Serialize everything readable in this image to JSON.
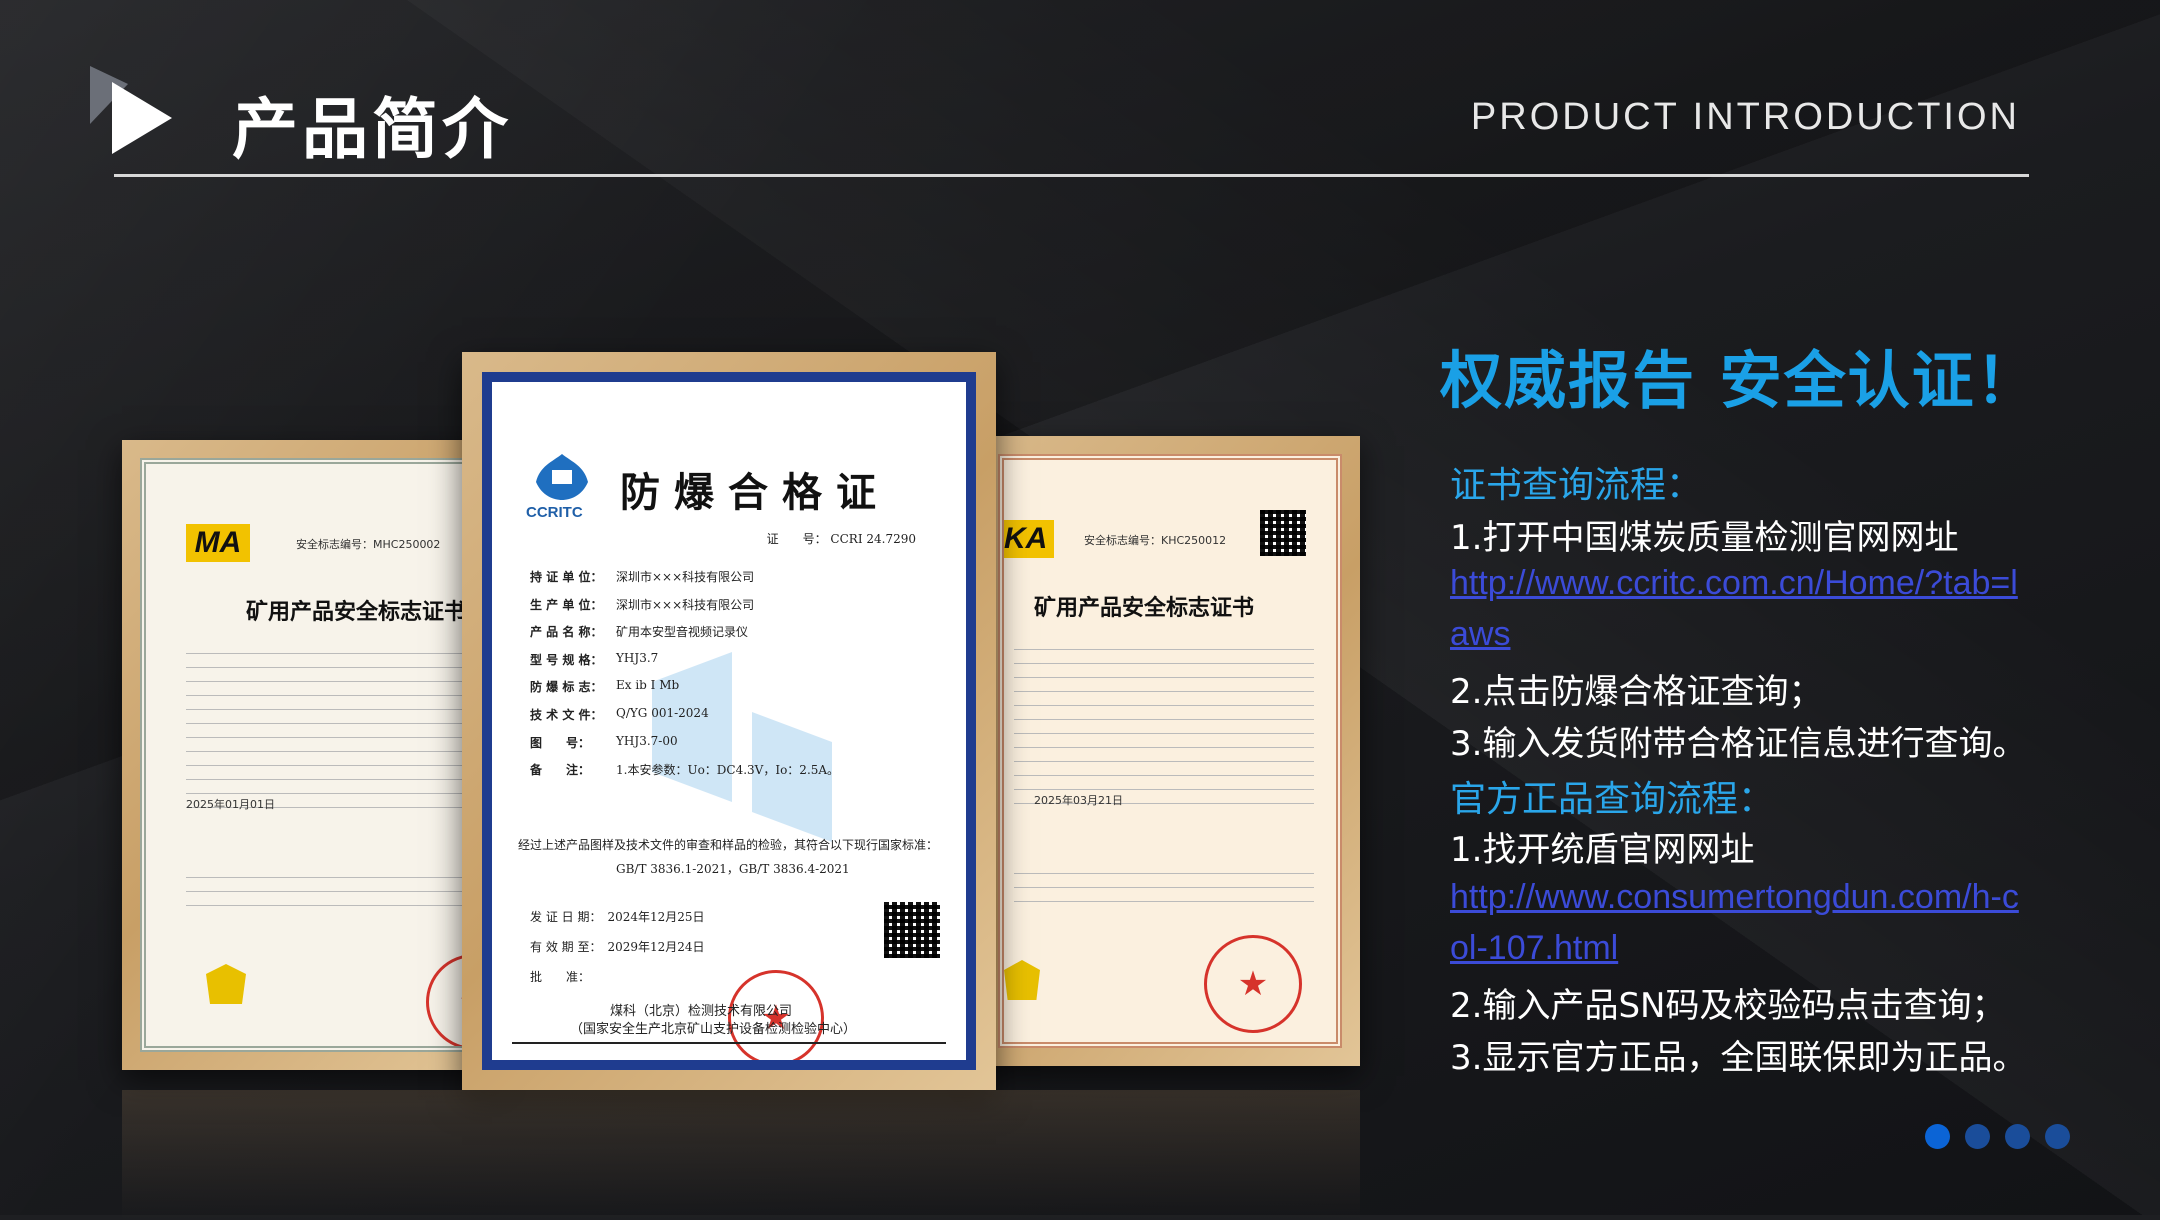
{
  "header": {
    "title": "产品简介",
    "subtitle": "PRODUCT INTRODUCTION"
  },
  "left_cert": {
    "logo": "MA",
    "mark_no": "安全标志编号：MHC250002",
    "title": "矿用产品安全标志证书",
    "date": "2025年01月01日"
  },
  "center_cert": {
    "logo_text": "CCRITC",
    "title": "防爆合格证",
    "cert_no_label": "证　　号：",
    "cert_no": "CCRI 24.7290",
    "rows": [
      {
        "k": "持 证 单 位：",
        "v": "深圳市×××科技有限公司"
      },
      {
        "k": "生 产 单 位：",
        "v": "深圳市×××科技有限公司"
      },
      {
        "k": "产 品 名 称：",
        "v": "矿用本安型音视频记录仪"
      },
      {
        "k": "型 号 规 格：",
        "v": "YHJ3.7"
      },
      {
        "k": "防 爆 标 志：",
        "v": "Ex ib I Mb"
      },
      {
        "k": "技 术 文 件：",
        "v": "Q/YG 001-2024"
      },
      {
        "k": "图　　号：",
        "v": "YHJ3.7-00"
      },
      {
        "k": "备　　注：",
        "v": "1.本安参数：Uo：DC4.3V，Io：2.5A。"
      }
    ],
    "conclusion": "经过上述产品图样及技术文件的审查和样品的检验，其符合以下现行国家标准：",
    "standards": "GB/T 3836.1-2021，GB/T 3836.4-2021",
    "issue_label": "发 证 日 期：",
    "issue_date": "2024年12月25日",
    "valid_label": "有 效 期 至：",
    "valid_date": "2029年12月24日",
    "approve_label": "批　　准：",
    "org": "煤科（北京）检测技术有限公司",
    "org_sub": "（国家安全生产北京矿山支护设备检测检验中心）"
  },
  "right_cert": {
    "logo": "KA",
    "mark_no": "安全标志编号：KHC250012",
    "title": "矿用产品安全标志证书",
    "date": "2025年03月21日"
  },
  "info": {
    "headline": "权威报告 安全认证！",
    "section1": "证书查询流程：",
    "s1_items": [
      "1.打开中国煤炭质量检测官网网址",
      "2.点击防爆合格证查询；",
      "3.输入发货附带合格证信息进行查询。"
    ],
    "s1_link": "http://www.ccritc.com.cn/Home/?tab=laws",
    "section2": "官方正品查询流程：",
    "s2_items": [
      "1.找开统盾官网网址",
      "2.输入产品SN码及校验码点击查询；",
      "3.显示官方正品，全国联保即为正品。"
    ],
    "s2_link": "http://www.consumertongdun.com/h-col-107.html"
  },
  "pagination": {
    "count": 4,
    "active": 0
  },
  "colors": {
    "accent": "#1aa0e6",
    "link": "#3b4bd8",
    "frame_blue": "#1f3c8f"
  }
}
